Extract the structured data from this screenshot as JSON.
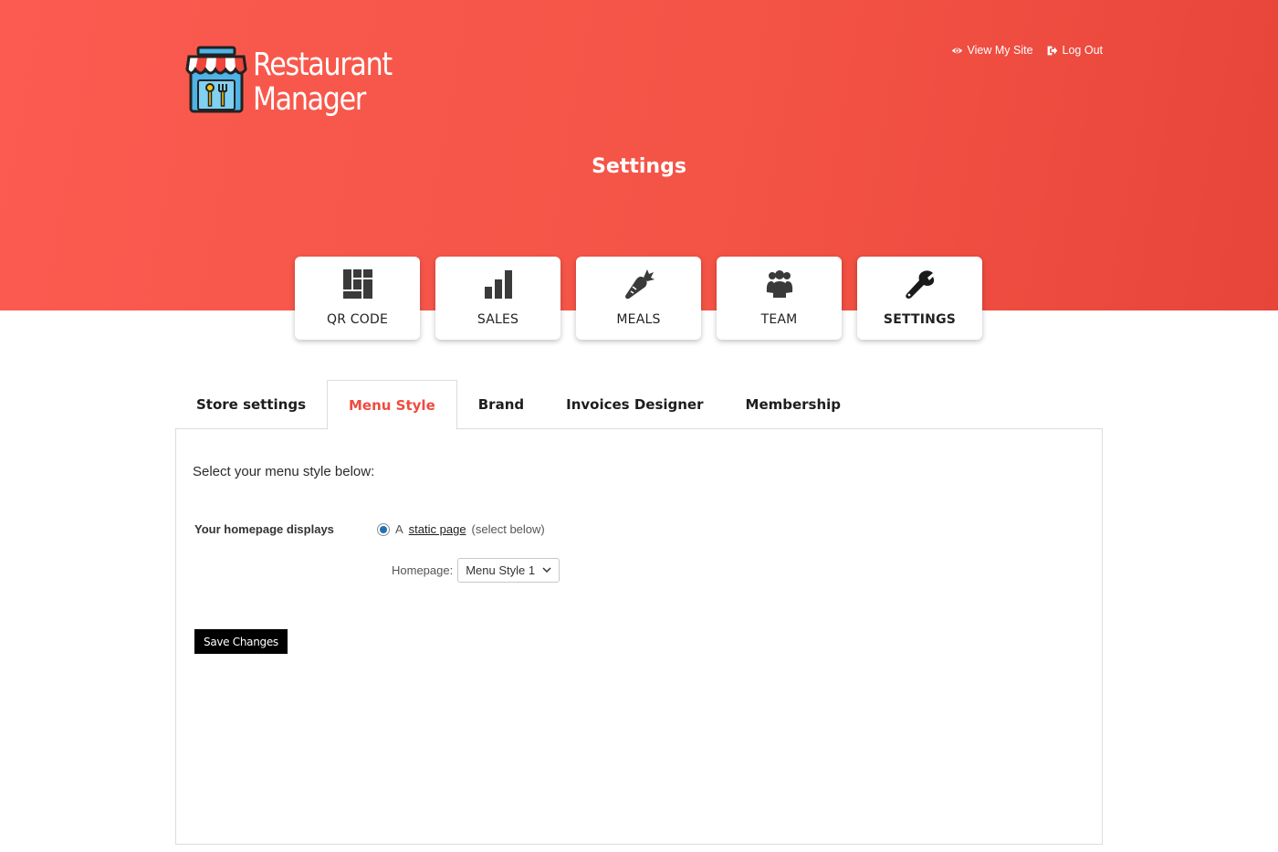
{
  "brand": {
    "line1": "Restaurant",
    "line2": "Manager"
  },
  "top_links": {
    "view_site": "View My Site",
    "logout": "Log Out"
  },
  "page_title": "Settings",
  "cards": [
    {
      "label": "QR CODE",
      "icon": "qr-code-icon"
    },
    {
      "label": "SALES",
      "icon": "bar-chart-icon"
    },
    {
      "label": "MEALS",
      "icon": "carrot-icon"
    },
    {
      "label": "TEAM",
      "icon": "team-icon"
    },
    {
      "label": "SETTINGS",
      "icon": "wrench-icon"
    }
  ],
  "tabs": [
    "Store settings",
    "Menu Style",
    "Brand",
    "Invoices Designer",
    "Membership"
  ],
  "active_tab": "Menu Style",
  "form": {
    "intro": "Select your menu style below:",
    "row_label": "Your homepage displays",
    "radio_prefix": "A",
    "radio_link": "static page",
    "radio_suffix": "(select below)",
    "homepage_label": "Homepage:",
    "homepage_value": "Menu Style 1",
    "save_label": "Save Changes"
  },
  "colors": {
    "accent": "#ef4b3f",
    "hero_start": "#fb5b50",
    "hero_end": "#e8453a",
    "radio": "#2271b1"
  }
}
